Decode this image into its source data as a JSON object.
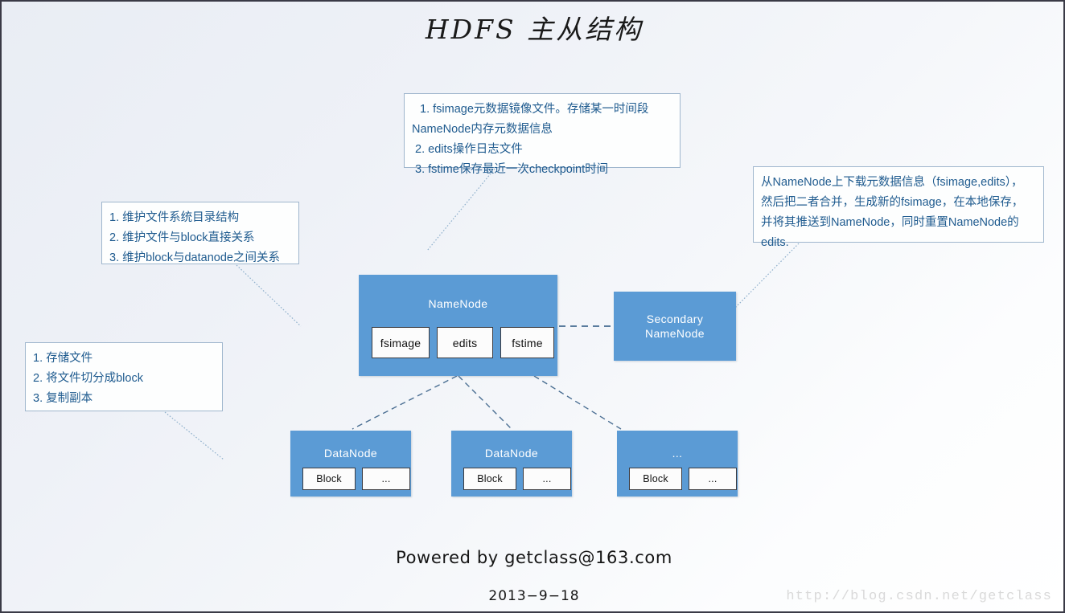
{
  "title": "HDFS 主从结构",
  "callouts": {
    "fsimage": {
      "name": "namenode-metadata-files-note",
      "lines": [
        " 1. fsimage元数据镜像文件。存储某一时间段",
        "NameNode内存元数据信息",
        " 2. edits操作日志文件",
        " 3. fstime保存最近一次checkpoint时间"
      ]
    },
    "namenode_duty": {
      "name": "namenode-responsibilities-note",
      "lines": [
        "1. 维护文件系统目录结构",
        "2. 维护文件与block直接关系",
        "3. 维护block与datanode之间关系"
      ]
    },
    "secondary": {
      "name": "secondary-namenode-role-note",
      "lines": [
        "从NameNode上下载元数据信息（fsimage,edits），",
        "然后把二者合并，生成新的fsimage，在本地保存，",
        "并将其推送到NameNode，同时重置NameNode的",
        "edits."
      ]
    },
    "datanode_duty": {
      "name": "datanode-responsibilities-note",
      "lines": [
        "1. 存储文件",
        "2. 将文件切分成block",
        "3. 复制副本"
      ]
    }
  },
  "nodes": {
    "namenode": {
      "label": "NameNode",
      "slots": [
        {
          "label": "fsimage"
        },
        {
          "label": "edits"
        },
        {
          "label": "fstime"
        }
      ]
    },
    "secondary": {
      "label_line1": "Secondary",
      "label_line2": "NameNode"
    },
    "datanodes": [
      {
        "label": "DataNode",
        "block": "Block",
        "more": "..."
      },
      {
        "label": "DataNode",
        "block": "Block",
        "more": "..."
      },
      {
        "label": "...",
        "block": "Block",
        "more": "..."
      }
    ]
  },
  "footer": {
    "powered": "Powered by getclass@163.com",
    "date": "2013−9−18",
    "watermark": "http://blog.csdn.net/getclass"
  },
  "colors": {
    "node_fill": "#5b9bd5",
    "note_text": "#1f5b8f",
    "note_border": "#9fb6cd",
    "connector": "#7fa6c8",
    "dashed_connector": "#4a6e92",
    "background_top": "#e9edf4",
    "background_bottom": "#ffffff"
  }
}
